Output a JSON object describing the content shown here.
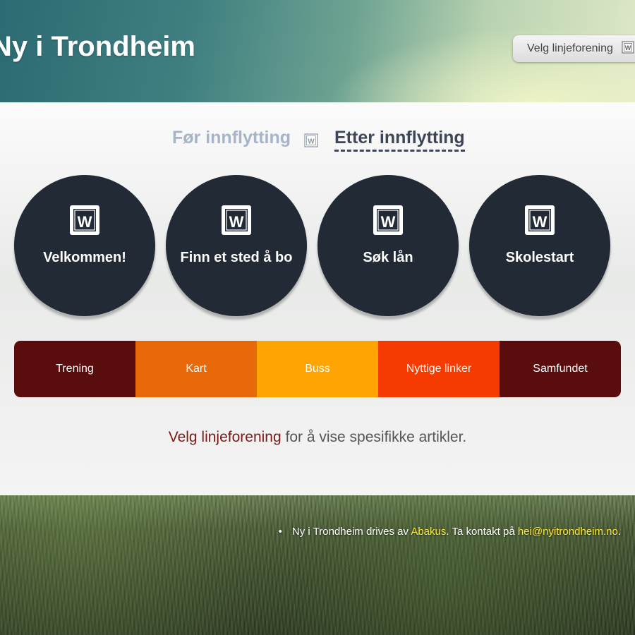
{
  "header": {
    "title": "Ny i Trondheim",
    "select_button": {
      "label": "Velg linjeforening",
      "icon": "abakus-logo-icon"
    }
  },
  "tabs": [
    {
      "label": "Før innflytting",
      "active": false,
      "color": "#a7b4c8"
    },
    {
      "label": "Etter innflytting",
      "active": true,
      "color": "#3d4656"
    }
  ],
  "tab_separator_icon": "abakus-logo-icon",
  "circles": [
    {
      "label": "Velkommen!",
      "icon": "abakus-logo-icon"
    },
    {
      "label": "Finn et sted å bo",
      "icon": "abakus-logo-icon"
    },
    {
      "label": "Søk lån",
      "icon": "abakus-logo-icon"
    },
    {
      "label": "Skolestart",
      "icon": "abakus-logo-icon"
    }
  ],
  "circle_color": "#222a36",
  "links_bar": [
    {
      "label": "Trening",
      "color": "#5a0d0d"
    },
    {
      "label": "Kart",
      "color": "#e8690a"
    },
    {
      "label": "Buss",
      "color": "#ffa400"
    },
    {
      "label": "Nyttige linker",
      "color": "#f53b00"
    },
    {
      "label": "Samfundet",
      "color": "#5a0d0d"
    }
  ],
  "notice": {
    "link": "Velg linjeforening",
    "text": " for å vise spesifikke artikler.",
    "link_color": "#7a1a16"
  },
  "footer": {
    "bullet": "•",
    "prefix": "Ny i Trondheim drives av ",
    "org_link": "Abakus",
    "middle": ". Ta kontakt på ",
    "email_link": "hei@nyitrondheim.no",
    "suffix": ".",
    "link_color": "#ffeb3b"
  }
}
